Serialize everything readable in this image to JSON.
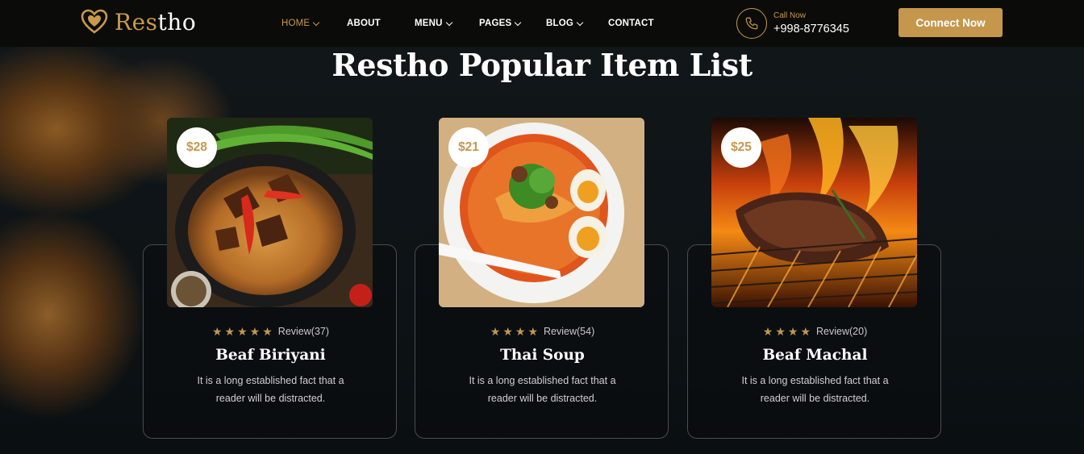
{
  "brand": {
    "logo_part1": "Res",
    "logo_part2": "tho",
    "accent": "#c89a4a"
  },
  "nav": {
    "items": [
      {
        "label": "HOME",
        "active": true,
        "dropdown": true
      },
      {
        "label": "ABOUT",
        "active": false,
        "dropdown": false
      },
      {
        "label": "MENU",
        "active": false,
        "dropdown": true
      },
      {
        "label": "PAGES",
        "active": false,
        "dropdown": true
      },
      {
        "label": "BLOG",
        "active": false,
        "dropdown": true
      },
      {
        "label": "CONTACT",
        "active": false,
        "dropdown": false
      }
    ]
  },
  "call": {
    "label": "Call Now",
    "number": "+998-8776345",
    "icon": "phone-icon"
  },
  "connect_button": {
    "label": "Connect Now"
  },
  "section": {
    "title": "Restho Popular Item List"
  },
  "cards": [
    {
      "price": "$28",
      "stars": 5,
      "review": "Review(37)",
      "title": "Beaf Biriyani",
      "desc": "It is a long established fact that a reader will be distracted.",
      "image": "biriyani-photo"
    },
    {
      "price": "$21",
      "stars": 4,
      "review": "Review(54)",
      "title": "Thai Soup",
      "desc": "It is a long established fact that a reader will be distracted.",
      "image": "thai-soup-photo"
    },
    {
      "price": "$25",
      "stars": 4,
      "review": "Review(20)",
      "title": "Beaf Machal",
      "desc": "It is a long established fact that a reader will be distracted.",
      "image": "grilled-steak-photo"
    }
  ]
}
